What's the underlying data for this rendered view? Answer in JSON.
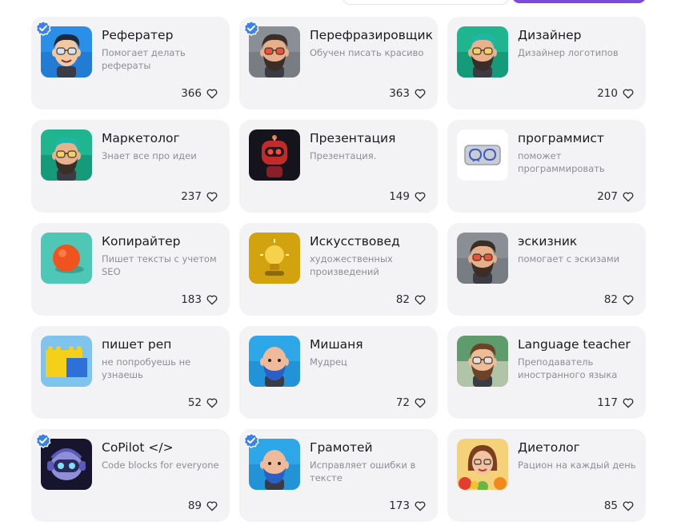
{
  "cards": [
    {
      "title": "Реферaтер",
      "desc": "Помогает делать рефераты",
      "likes": "366",
      "verified": true,
      "icon": "cartoon-man-glasses-icon"
    },
    {
      "title": "Перефразировщик",
      "desc": "Обучен писать красиво",
      "likes": "363",
      "verified": true,
      "icon": "bearded-man-red-glasses-icon"
    },
    {
      "title": "Дизайнер",
      "desc": "Дизайнер логотипов",
      "likes": "210",
      "verified": false,
      "icon": "teal-hair-bearded-man-icon"
    },
    {
      "title": "Маркетолог",
      "desc": "Знает все про идеи",
      "likes": "237",
      "verified": false,
      "icon": "teal-hair-bearded-man-icon"
    },
    {
      "title": "Презентация",
      "desc": "Презентация.",
      "likes": "149",
      "verified": false,
      "icon": "robot-icon"
    },
    {
      "title": "программист",
      "desc": "поможет программировать",
      "likes": "207",
      "verified": false,
      "icon": "code-glasses-icon"
    },
    {
      "title": "Копирайтер",
      "desc": "Пишет тексты с учетом SEO",
      "likes": "183",
      "verified": false,
      "icon": "orange-ball-icon"
    },
    {
      "title": "Искусствовед",
      "desc": "художественных произведений",
      "likes": "82",
      "verified": false,
      "icon": "lightbulb-icon"
    },
    {
      "title": "эскизник",
      "desc": "помогает с эскизами",
      "likes": "82",
      "verified": false,
      "icon": "bearded-man-red-glasses-icon"
    },
    {
      "title": "пишет реп",
      "desc": "не попробуешь не узнаешь",
      "likes": "52",
      "verified": false,
      "icon": "lego-bricks-icon"
    },
    {
      "title": "Мишаня",
      "desc": "Мудрец",
      "likes": "72",
      "verified": false,
      "icon": "bald-blue-beard-man-icon"
    },
    {
      "title": "Language teacher",
      "desc": "Преподаватель иностранного языка",
      "likes": "117",
      "verified": false,
      "icon": "teacher-man-icon"
    },
    {
      "title": "CoPilot </>",
      "desc": "Code blocks for everyone",
      "likes": "89",
      "verified": true,
      "icon": "copilot-robot-icon"
    },
    {
      "title": "Грамотей",
      "desc": "Исправляет ошибки в тексте",
      "likes": "173",
      "verified": true,
      "icon": "bald-blue-beard-man-icon"
    },
    {
      "title": "Диетолог",
      "desc": "Рацион на каждый день",
      "likes": "85",
      "verified": false,
      "icon": "woman-fruits-icon"
    }
  ],
  "colors": {
    "card_bg": "#f3f3f5",
    "verified_badge": "#3b82e6",
    "accent_button": "#7b4bd9"
  }
}
